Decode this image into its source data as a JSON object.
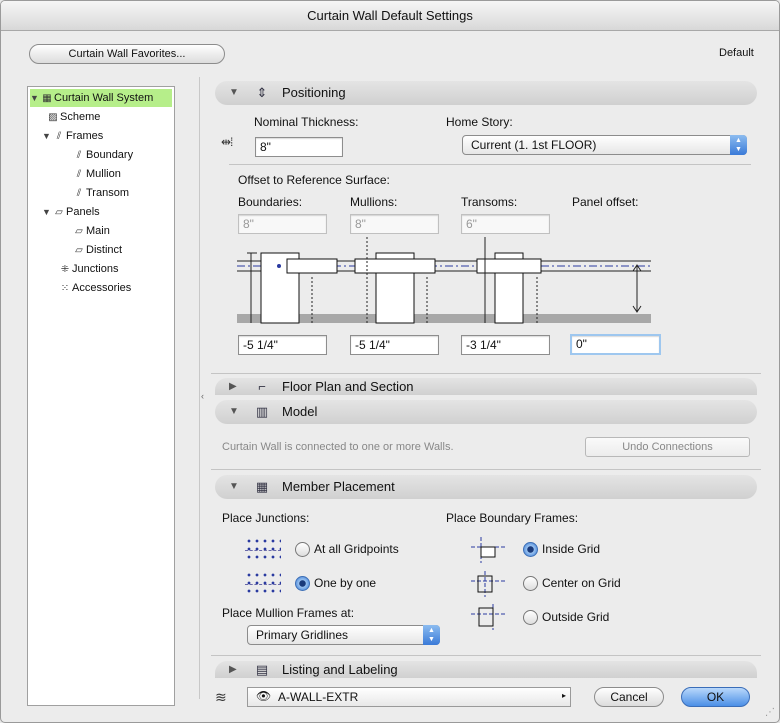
{
  "window": {
    "title": "Curtain Wall Default Settings"
  },
  "header": {
    "favorites_label": "Curtain Wall Favorites...",
    "default_label": "Default"
  },
  "tree": {
    "items": [
      {
        "label": "Curtain Wall System"
      },
      {
        "label": "Scheme"
      },
      {
        "label": "Frames"
      },
      {
        "label": "Boundary"
      },
      {
        "label": "Mullion"
      },
      {
        "label": "Transom"
      },
      {
        "label": "Panels"
      },
      {
        "label": "Main"
      },
      {
        "label": "Distinct"
      },
      {
        "label": "Junctions"
      },
      {
        "label": "Accessories"
      }
    ]
  },
  "positioning": {
    "title": "Positioning",
    "nominal_thickness_label": "Nominal Thickness:",
    "nominal_thickness_value": "8\"",
    "home_story_label": "Home Story:",
    "home_story_value": "Current (1. 1st FLOOR)",
    "offset_label": "Offset to Reference Surface:",
    "boundaries_label": "Boundaries:",
    "boundaries_value": "8\"",
    "mullions_label": "Mullions:",
    "mullions_value": "8\"",
    "transoms_label": "Transoms:",
    "transoms_value": "6\"",
    "panel_offset_label": "Panel offset:",
    "boundaries_offset": "-5 1/4\"",
    "mullions_offset": "-5 1/4\"",
    "transoms_offset": "-3 1/4\"",
    "panel_offset_value": "0\""
  },
  "floor_plan": {
    "title": "Floor Plan and Section"
  },
  "model": {
    "title": "Model",
    "connected_text": "Curtain Wall is connected to one or more Walls.",
    "undo_label": "Undo Connections"
  },
  "member_placement": {
    "title": "Member Placement",
    "place_junctions_label": "Place Junctions:",
    "junction_all": "At all Gridpoints",
    "junction_one": "One by one",
    "junction_selected": "One by one",
    "place_boundary_label": "Place Boundary Frames:",
    "boundary_inside": "Inside Grid",
    "boundary_center": "Center on Grid",
    "boundary_outside": "Outside Grid",
    "boundary_selected": "Inside Grid",
    "place_mullion_label": "Place Mullion Frames at:",
    "mullion_value": "Primary Gridlines"
  },
  "listing": {
    "title": "Listing and Labeling"
  },
  "footer": {
    "layer_value": "A-WALL-EXTR",
    "cancel_label": "Cancel",
    "ok_label": "OK"
  },
  "colors": {
    "selection": "#b6ee8a",
    "accent": "#4b8fe6",
    "focus": "#9ec7ef"
  },
  "icons": {
    "header": "curtain-wall-icon",
    "positioning": "positioning-icon",
    "floor_plan": "floor-plan-icon",
    "model": "model-icon",
    "member": "member-placement-icon",
    "listing": "listing-icon",
    "layer": "layer-icon",
    "eye": "eye-icon"
  }
}
